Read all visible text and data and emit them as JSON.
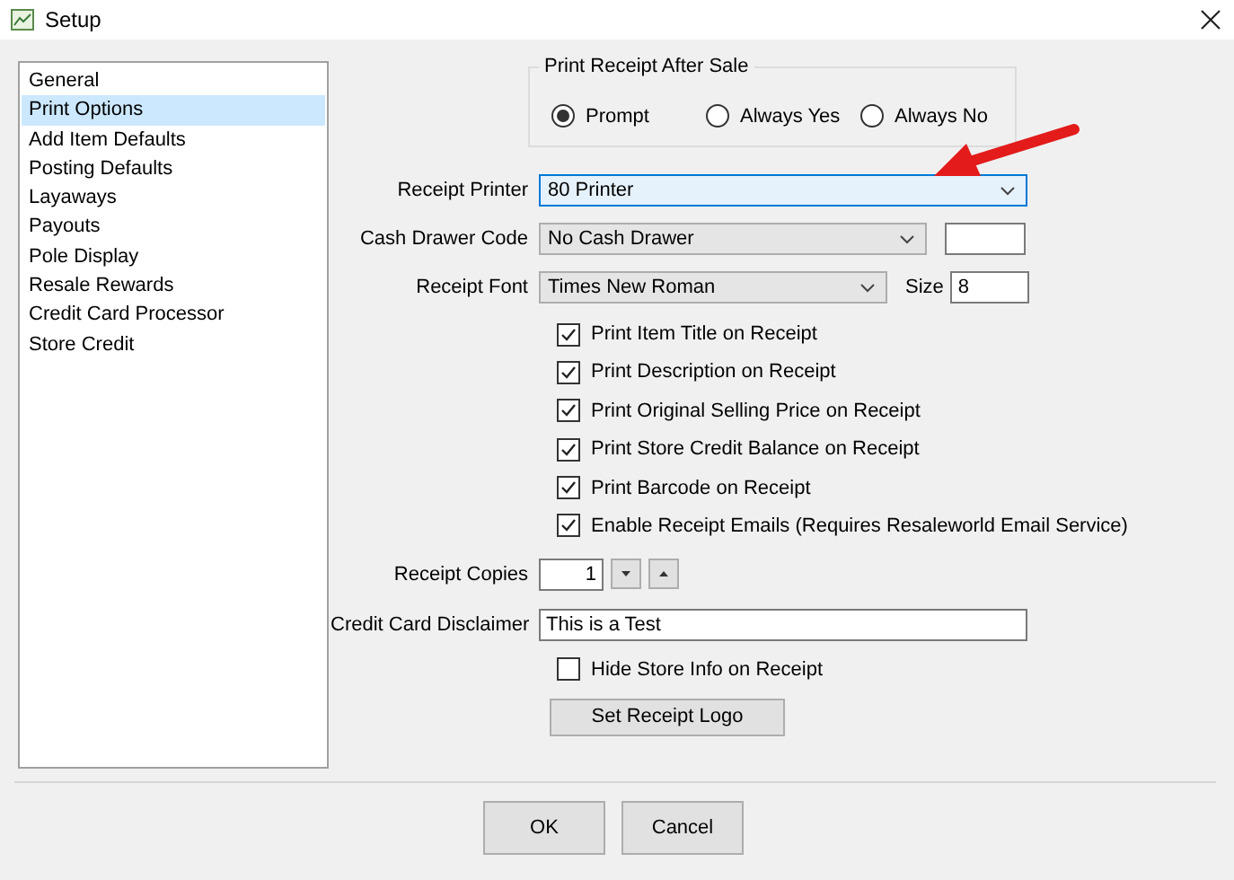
{
  "window": {
    "title": "Setup"
  },
  "sidebar": {
    "items": [
      {
        "label": "General",
        "selected": false
      },
      {
        "label": "Print Options",
        "selected": true
      },
      {
        "label": "Add Item Defaults",
        "selected": false
      },
      {
        "label": "Posting Defaults",
        "selected": false
      },
      {
        "label": "Layaways",
        "selected": false
      },
      {
        "label": "Payouts",
        "selected": false
      },
      {
        "label": "Pole Display",
        "selected": false
      },
      {
        "label": "Resale Rewards",
        "selected": false
      },
      {
        "label": "Credit Card Processor",
        "selected": false
      },
      {
        "label": "Store Credit",
        "selected": false
      }
    ]
  },
  "print_receipt_after_sale": {
    "title": "Print Receipt After Sale",
    "options": [
      {
        "label": "Prompt",
        "selected": true
      },
      {
        "label": "Always Yes",
        "selected": false
      },
      {
        "label": "Always No",
        "selected": false
      }
    ]
  },
  "receipt_printer": {
    "label": "Receipt Printer",
    "value": "80 Printer"
  },
  "cash_drawer_code": {
    "label": "Cash Drawer Code",
    "value": "No Cash Drawer"
  },
  "receipt_font": {
    "label": "Receipt Font",
    "value": "Times New Roman",
    "size_label": "Size",
    "size": "8"
  },
  "checkboxes": [
    {
      "label": "Print Item Title on Receipt",
      "checked": true
    },
    {
      "label": "Print Description on Receipt",
      "checked": true
    },
    {
      "label": "Print Original Selling Price on Receipt",
      "checked": true
    },
    {
      "label": "Print Store Credit Balance on Receipt",
      "checked": true
    },
    {
      "label": "Print Barcode on Receipt",
      "checked": true
    },
    {
      "label": "Enable Receipt Emails (Requires Resaleworld Email Service)",
      "checked": true
    }
  ],
  "receipt_copies": {
    "label": "Receipt Copies",
    "value": "1"
  },
  "credit_card_disclaimer": {
    "label": "Credit Card Disclaimer",
    "value": "This is a Test"
  },
  "hide_store_info": {
    "label": "Hide Store Info on Receipt",
    "checked": false
  },
  "logo_button": "Set Receipt Logo",
  "buttons": [
    "OK",
    "Cancel"
  ]
}
